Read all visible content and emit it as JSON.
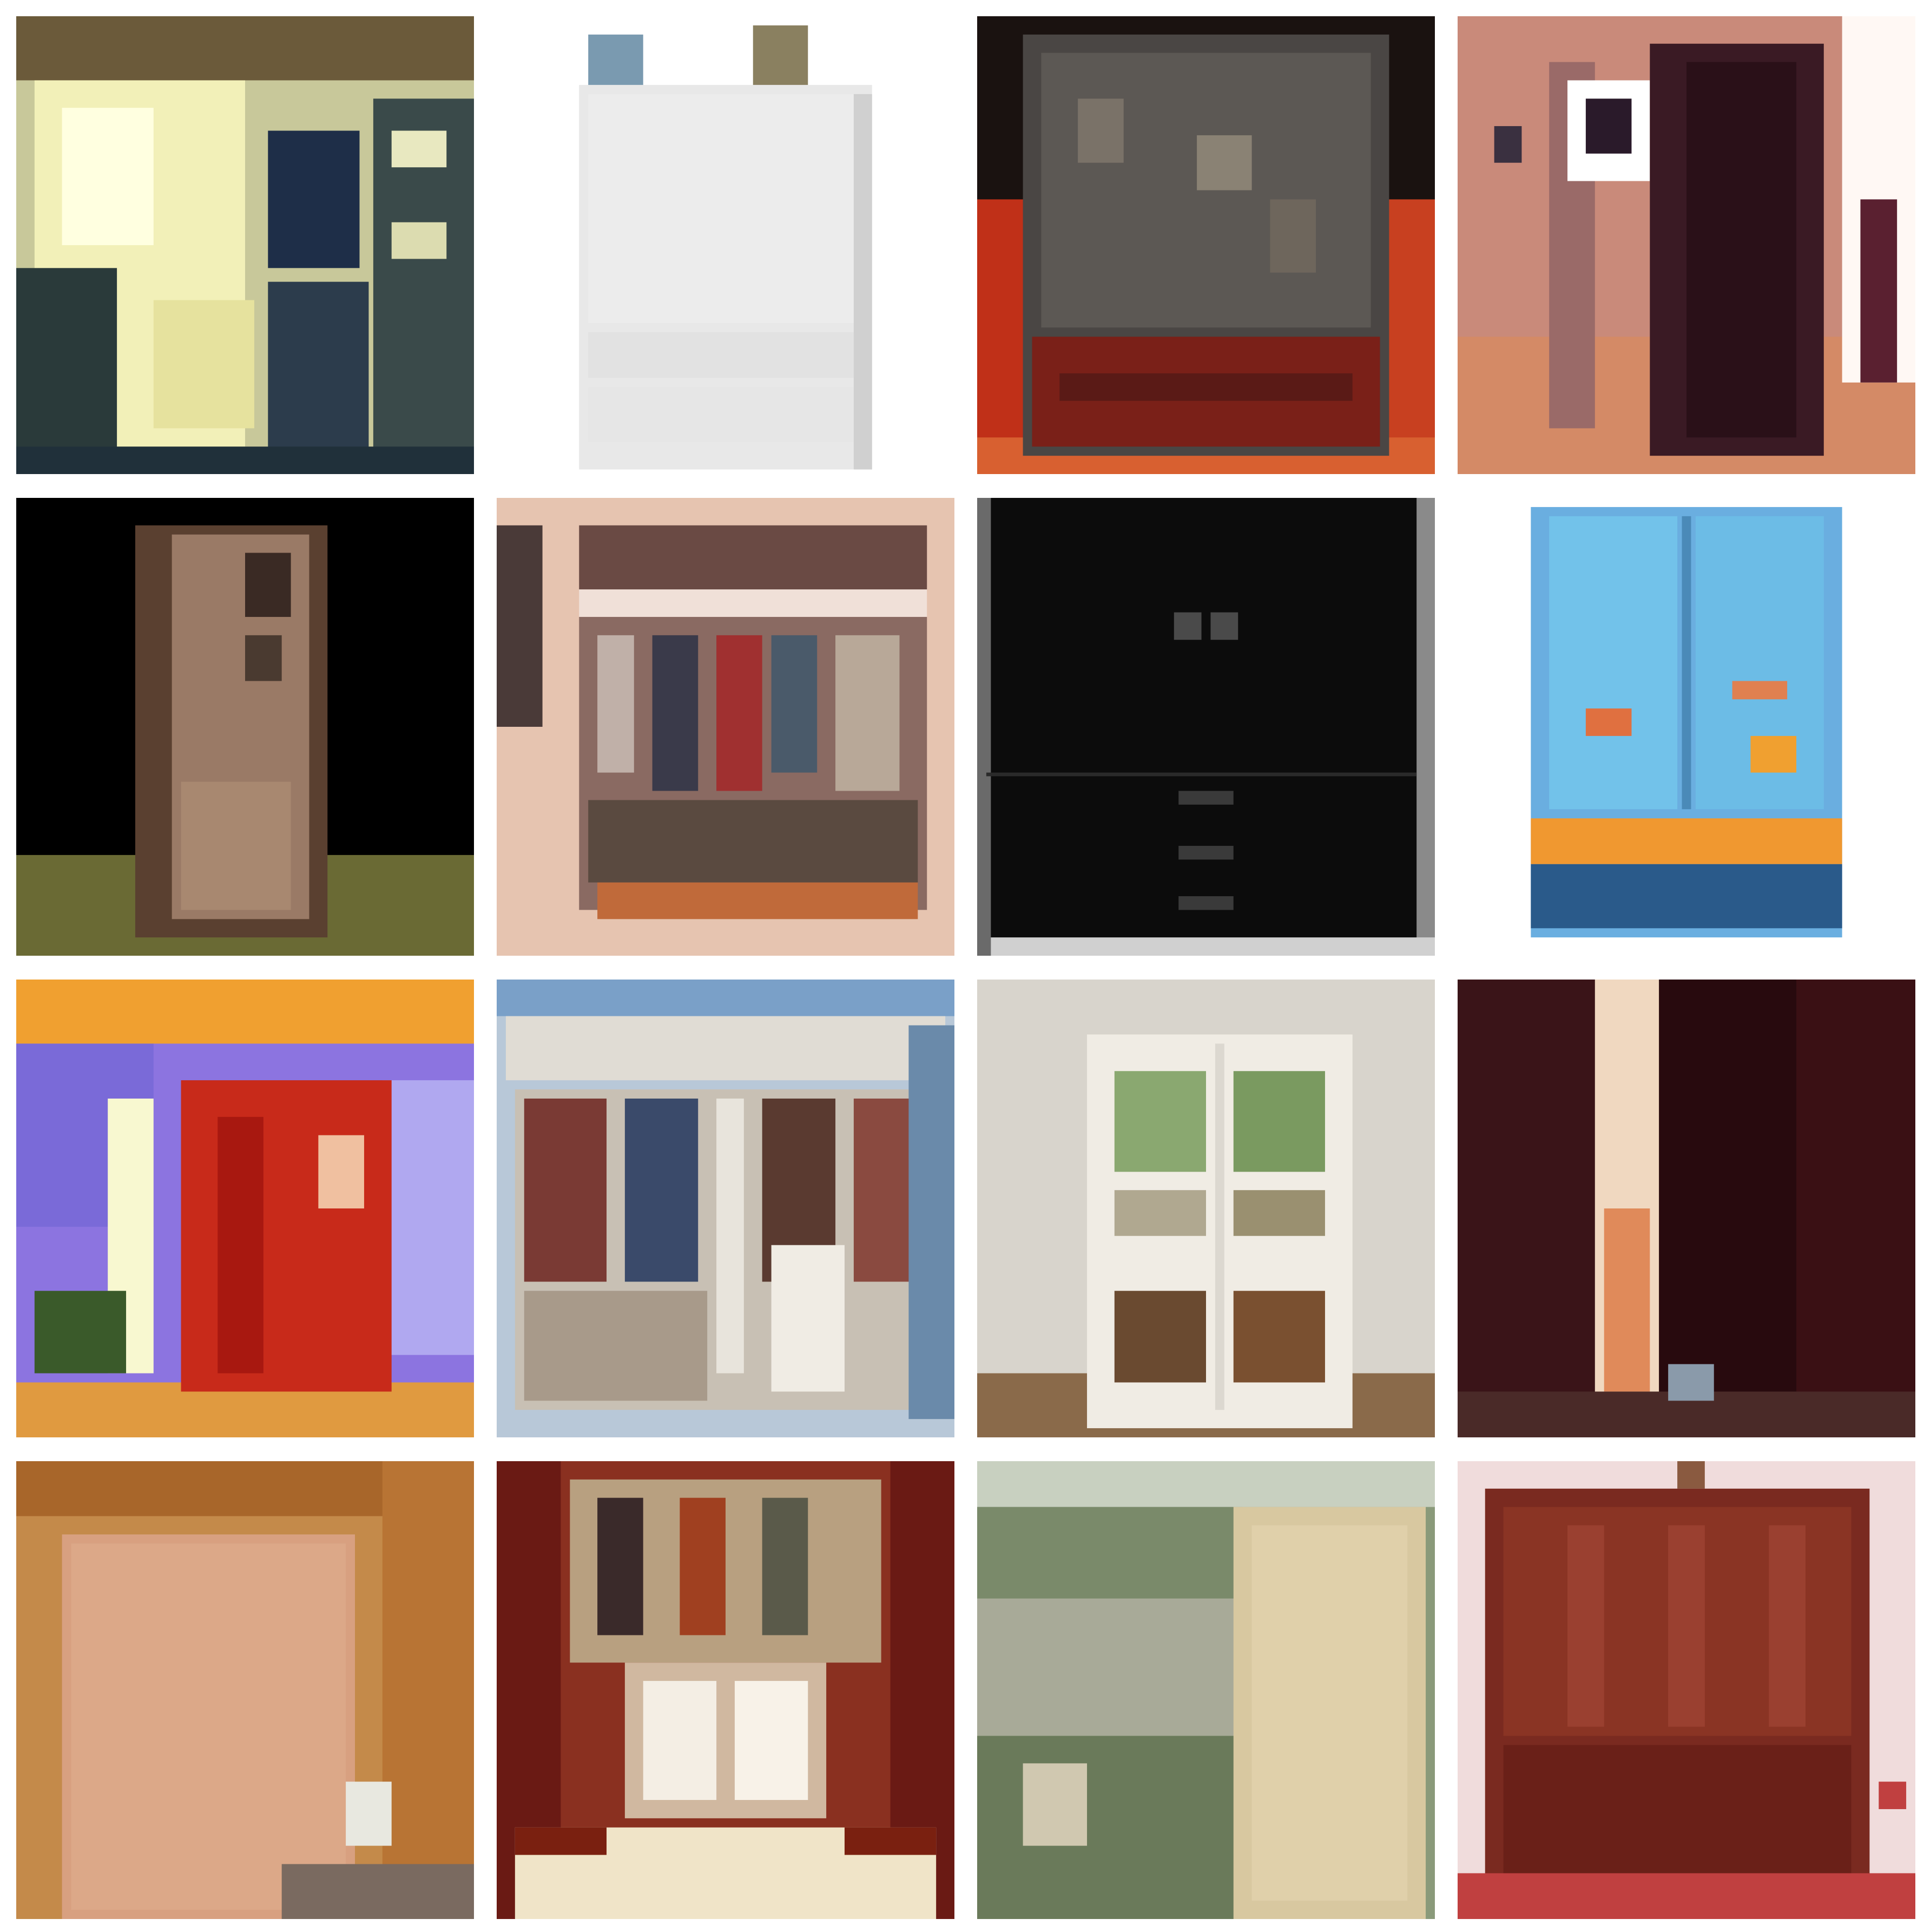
{
  "gallery": {
    "tiles": [
      {
        "subject": "wardrobe-closet-yellow-light",
        "background": "#c8c89a"
      },
      {
        "subject": "white-wardrobe-on-white",
        "background": "#ffffff"
      },
      {
        "subject": "dark-armoire-red-floor",
        "background": "#2a2420"
      },
      {
        "subject": "open-closet-pink-room",
        "background": "#c98a7a"
      },
      {
        "subject": "tall-cabinet-black-bg",
        "background": "#000000"
      },
      {
        "subject": "open-closet-clothes-beige",
        "background": "#e6c4b0"
      },
      {
        "subject": "black-wardrobe-drawers",
        "background": "#111111"
      },
      {
        "subject": "blue-painted-wardrobe",
        "background": "#ffffff"
      },
      {
        "subject": "red-cabinet-purple-wall",
        "background": "#8c74e0"
      },
      {
        "subject": "open-white-closet-blue-wall",
        "background": "#b8c8d8"
      },
      {
        "subject": "white-glass-door-armoire",
        "background": "#d8d4cc"
      },
      {
        "subject": "dark-wardrobe-open-door",
        "background": "#2a0c10"
      },
      {
        "subject": "wood-room-wardrobe",
        "background": "#c48a4a"
      },
      {
        "subject": "walk-in-closet-red-trim",
        "background": "#8a3020"
      },
      {
        "subject": "beige-wardrobe-outdoor",
        "background": "#8a9a7a"
      },
      {
        "subject": "mahogany-wardrobe-pink-wall",
        "background": "#f0dcdc"
      }
    ]
  }
}
